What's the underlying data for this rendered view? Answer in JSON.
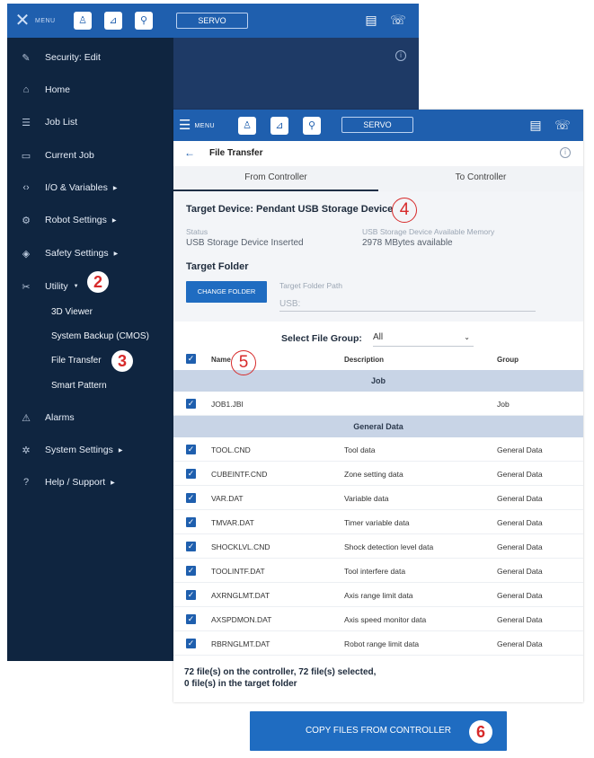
{
  "toolbar": {
    "menu_label": "MENU",
    "servo_label": "SERVO",
    "icons": [
      "robot-icon",
      "coordinate-icon",
      "user-icon"
    ],
    "right_icons": [
      "chat-icon",
      "teach-pendant-icon"
    ]
  },
  "side_menu": {
    "items": [
      {
        "label": "Security: Edit",
        "icon": "wrench-icon",
        "has_arrow": false
      },
      {
        "label": "Home",
        "icon": "home-icon",
        "has_arrow": false
      },
      {
        "label": "Job List",
        "icon": "list-icon",
        "has_arrow": false
      },
      {
        "label": "Current Job",
        "icon": "job-icon",
        "has_arrow": false
      },
      {
        "label": "I/O & Variables",
        "icon": "code-icon",
        "has_arrow": true
      },
      {
        "label": "Robot Settings",
        "icon": "robot-arm-icon",
        "has_arrow": true
      },
      {
        "label": "Safety Settings",
        "icon": "shield-icon",
        "has_arrow": true
      },
      {
        "label": "Utility",
        "icon": "tools-icon",
        "has_arrow": true
      },
      {
        "label": "Alarms",
        "icon": "warning-icon",
        "has_arrow": false
      },
      {
        "label": "System Settings",
        "icon": "gear-icon",
        "has_arrow": true
      },
      {
        "label": "Help / Support",
        "icon": "help-icon",
        "has_arrow": true
      }
    ],
    "utility_sub": [
      "3D Viewer",
      "System Backup (CMOS)",
      "File Transfer",
      "Smart Pattern"
    ]
  },
  "file_transfer": {
    "title": "File Transfer",
    "tabs": [
      "From Controller",
      "To Controller"
    ],
    "target_device": "Target Device: Pendant USB Storage Device",
    "status_label": "Status",
    "status_value": "USB Storage Device Inserted",
    "memory_label": "USB Storage Device Available Memory",
    "memory_value": "2978 MBytes available",
    "target_folder_heading": "Target Folder",
    "change_folder_label": "CHANGE FOLDER",
    "folder_path_label": "Target Folder Path",
    "folder_path_placeholder": "USB:",
    "select_group_label": "Select File Group:",
    "select_group_value": "All",
    "columns": {
      "name": "Name",
      "description": "Description",
      "group": "Group"
    },
    "groups": [
      {
        "label": "Job",
        "files": [
          {
            "name": "JOB1.JBI",
            "description": "",
            "group": "Job"
          }
        ]
      },
      {
        "label": "General Data",
        "files": [
          {
            "name": "TOOL.CND",
            "description": "Tool data",
            "group": "General Data"
          },
          {
            "name": "CUBEINTF.CND",
            "description": "Zone setting data",
            "group": "General Data"
          },
          {
            "name": "VAR.DAT",
            "description": "Variable data",
            "group": "General Data"
          },
          {
            "name": "TMVAR.DAT",
            "description": "Timer variable data",
            "group": "General Data"
          },
          {
            "name": "SHOCKLVL.CND",
            "description": "Shock detection level data",
            "group": "General Data"
          },
          {
            "name": "TOOLINTF.DAT",
            "description": "Tool interfere data",
            "group": "General Data"
          },
          {
            "name": "AXRNGLMT.DAT",
            "description": "Axis range limit data",
            "group": "General Data"
          },
          {
            "name": "AXSPDMON.DAT",
            "description": "Axis speed monitor data",
            "group": "General Data"
          },
          {
            "name": "RBRNGLMT.DAT",
            "description": "Robot range limit data",
            "group": "General Data"
          }
        ]
      }
    ],
    "summary_line1": "72 file(s) on the controller, 72 file(s) selected,",
    "summary_line2": "0 file(s) in the target folder",
    "copy_button_label": "COPY FILES FROM CONTROLLER"
  },
  "annotations": [
    "2",
    "3",
    "4",
    "5",
    "6"
  ],
  "colors": {
    "toolbar": "#1f5fae",
    "side_menu": "#0f2540",
    "accent": "#1f6cc1",
    "group_bar": "#c8d4e6",
    "callout": "#d72a2a"
  }
}
